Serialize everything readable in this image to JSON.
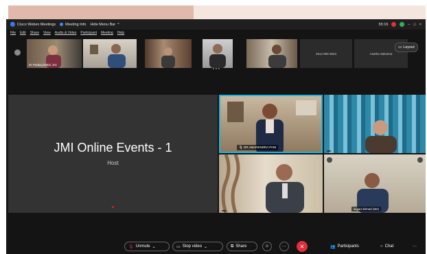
{
  "window": {
    "app_name": "Cisco Webex Meetings",
    "meeting_info": "Meeting Info",
    "hide_menu_bar": "Hide Menu Bar",
    "timer": "55:16",
    "minimize": "–",
    "maximize": "□",
    "close": "×"
  },
  "menu": [
    "File",
    "Edit",
    "Share",
    "View",
    "Audio & Video",
    "Participant",
    "Meeting",
    "Help"
  ],
  "strip": {
    "thumbnails": [
      {
        "name": "Dr Pankaj Mittal, SG"
      },
      {
        "name": ""
      },
      {
        "name": ""
      },
      {
        "name": ""
      },
      {
        "name": ""
      }
    ],
    "tiles": [
      {
        "label": "2514 906 6843"
      },
      {
        "label": "Aastha Saksena"
      }
    ],
    "layout_label": "Layout"
  },
  "host": {
    "title": "JMI Online Events - 1",
    "role": "Host"
  },
  "videos": [
    {
      "name": "DR AMARENDRA PANI"
    },
    {
      "name": ""
    },
    {
      "name": ""
    },
    {
      "name": "sajjad ahmad (Me)"
    }
  ],
  "toolbar": {
    "unmute": "Unmute",
    "stop_video": "Stop video",
    "share": "Share",
    "participants": "Participants",
    "chat": "Chat",
    "more": "···"
  },
  "colors": {
    "accent_blue": "#3c8cff",
    "end_red": "#e0303c",
    "active_speaker": "#24b3e0"
  }
}
